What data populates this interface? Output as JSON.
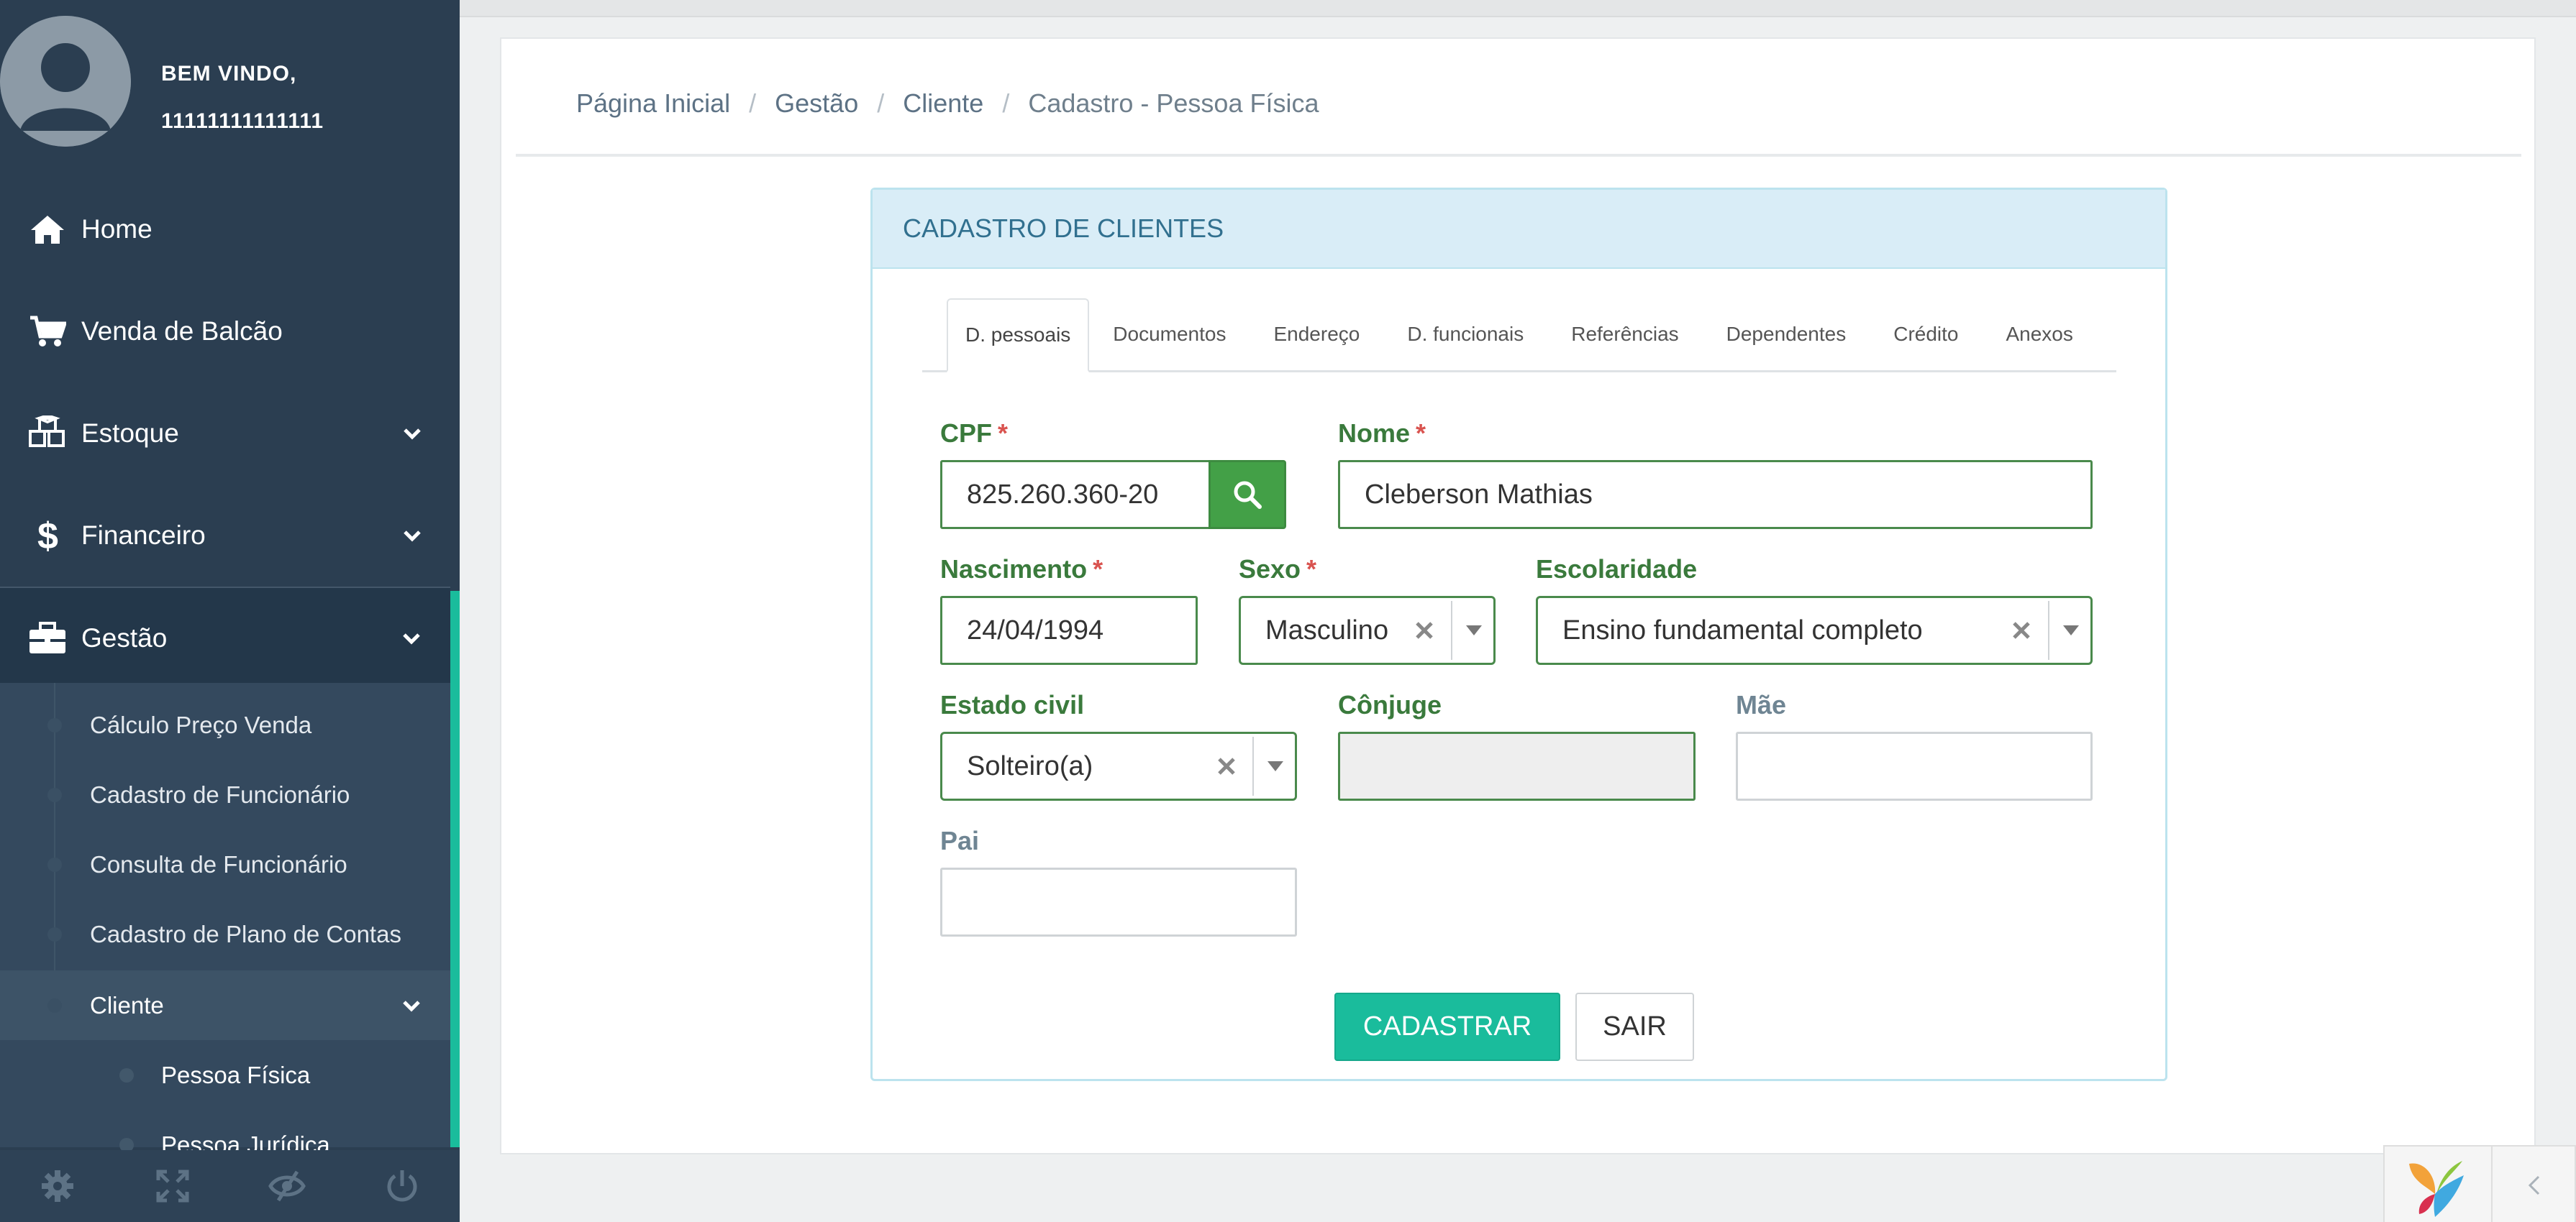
{
  "user": {
    "greeting": "BEM VINDO,",
    "id": "11111111111111"
  },
  "menu": {
    "home": "Home",
    "venda": "Venda de Balcão",
    "estoque": "Estoque",
    "financeiro": "Financeiro",
    "gestao": "Gestão",
    "gestao_items": [
      "Cálculo Preço Venda",
      "Cadastro de Funcionário",
      "Consulta de Funcionário",
      "Cadastro de Plano de Contas",
      "Cliente"
    ],
    "cliente_items": [
      "Pessoa Física",
      "Pessoa Jurídica"
    ]
  },
  "breadcrumb": [
    "Página Inicial",
    "Gestão",
    "Cliente",
    "Cadastro - Pessoa Física"
  ],
  "form": {
    "title": "CADASTRO DE CLIENTES",
    "tabs": [
      "D. pessoais",
      "Documentos",
      "Endereço",
      "D. funcionais",
      "Referências",
      "Dependentes",
      "Crédito",
      "Anexos"
    ],
    "active_tab": "D. pessoais",
    "required_mark": "*",
    "cpf": {
      "label": "CPF",
      "value": "825.260.360-20"
    },
    "nome": {
      "label": "Nome",
      "value": "Cleberson Mathias"
    },
    "nascimento": {
      "label": "Nascimento",
      "value": "24/04/1994"
    },
    "sexo": {
      "label": "Sexo",
      "value": "Masculino"
    },
    "escolaridade": {
      "label": "Escolaridade",
      "value": "Ensino fundamental completo"
    },
    "estado_civil": {
      "label": "Estado civil",
      "value": "Solteiro(a)"
    },
    "conjuge": {
      "label": "Cônjuge",
      "value": ""
    },
    "mae": {
      "label": "Mãe",
      "value": ""
    },
    "pai": {
      "label": "Pai",
      "value": ""
    },
    "submit": "CADASTRAR",
    "exit": "SAIR"
  },
  "colors": {
    "sidebar": "#2b3e51",
    "accent": "#1abc9c",
    "valid_green": "#3a7a3c",
    "panel_head": "#d9edf7"
  },
  "icons": {
    "home": "home-icon",
    "venda": "cart-icon",
    "estoque": "cubes-icon",
    "financeiro": "dollar-icon",
    "gestao": "briefcase-icon",
    "footer": [
      "gear-icon",
      "fullscreen-icon",
      "eye-slash-icon",
      "power-icon"
    ]
  }
}
